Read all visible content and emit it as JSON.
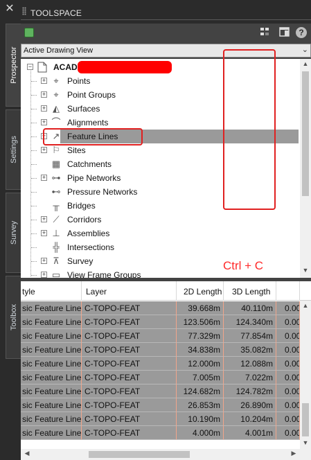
{
  "window": {
    "title": "TOOLSPACE",
    "close_glyph": "✕"
  },
  "side_tabs": [
    {
      "label": "Prospector",
      "active": true
    },
    {
      "label": "Settings",
      "active": false
    },
    {
      "label": "Survey",
      "active": false
    },
    {
      "label": "Toolbox",
      "active": false
    }
  ],
  "toolbar": {
    "help_label": "?"
  },
  "view_selector": {
    "value": "Active Drawing View"
  },
  "tree": {
    "root_label": "ACAD",
    "items": [
      {
        "label": "Points",
        "icon": "points-icon"
      },
      {
        "label": "Point Groups",
        "icon": "point-groups-icon"
      },
      {
        "label": "Surfaces",
        "icon": "surfaces-icon"
      },
      {
        "label": "Alignments",
        "icon": "alignments-icon"
      },
      {
        "label": "Feature Lines",
        "icon": "feature-lines-icon",
        "selected": true
      },
      {
        "label": "Sites",
        "icon": "sites-icon"
      },
      {
        "label": "Catchments",
        "icon": "catchments-icon"
      },
      {
        "label": "Pipe Networks",
        "icon": "pipe-networks-icon"
      },
      {
        "label": "Pressure Networks",
        "icon": "pressure-networks-icon"
      },
      {
        "label": "Bridges",
        "icon": "bridges-icon"
      },
      {
        "label": "Corridors",
        "icon": "corridors-icon"
      },
      {
        "label": "Assemblies",
        "icon": "assemblies-icon"
      },
      {
        "label": "Intersections",
        "icon": "intersections-icon"
      },
      {
        "label": "Survey",
        "icon": "survey-icon"
      },
      {
        "label": "View Frame Groups",
        "icon": "view-frame-groups-icon"
      }
    ]
  },
  "annotation": {
    "label": "Ctrl + C",
    "color": "#ff2a2a"
  },
  "grid": {
    "columns": [
      "tyle",
      "Layer",
      "2D Length",
      "3D Length",
      ""
    ],
    "rows": [
      [
        "sic Feature Line",
        "C-TOPO-FEAT",
        "39.668m",
        "40.110m",
        "0.00"
      ],
      [
        "sic Feature Line",
        "C-TOPO-FEAT",
        "123.506m",
        "124.340m",
        "0.00"
      ],
      [
        "sic Feature Line",
        "C-TOPO-FEAT",
        "77.329m",
        "77.854m",
        "0.00"
      ],
      [
        "sic Feature Line",
        "C-TOPO-FEAT",
        "34.838m",
        "35.082m",
        "0.00"
      ],
      [
        "sic Feature Line",
        "C-TOPO-FEAT",
        "12.000m",
        "12.088m",
        "0.00"
      ],
      [
        "sic Feature Line",
        "C-TOPO-FEAT",
        "7.005m",
        "7.022m",
        "0.00"
      ],
      [
        "sic Feature Line",
        "C-TOPO-FEAT",
        "124.682m",
        "124.782m",
        "0.00"
      ],
      [
        "sic Feature Line",
        "C-TOPO-FEAT",
        "26.853m",
        "26.890m",
        "0.00"
      ],
      [
        "sic Feature Line",
        "C-TOPO-FEAT",
        "10.190m",
        "10.204m",
        "0.00"
      ],
      [
        "sic Feature Line",
        "C-TOPO-FEAT",
        "4.000m",
        "4.001m",
        "0.00"
      ]
    ]
  },
  "colors": {
    "selection": "#9a9a9a",
    "highlight": "#e02020",
    "panel": "#434343"
  }
}
